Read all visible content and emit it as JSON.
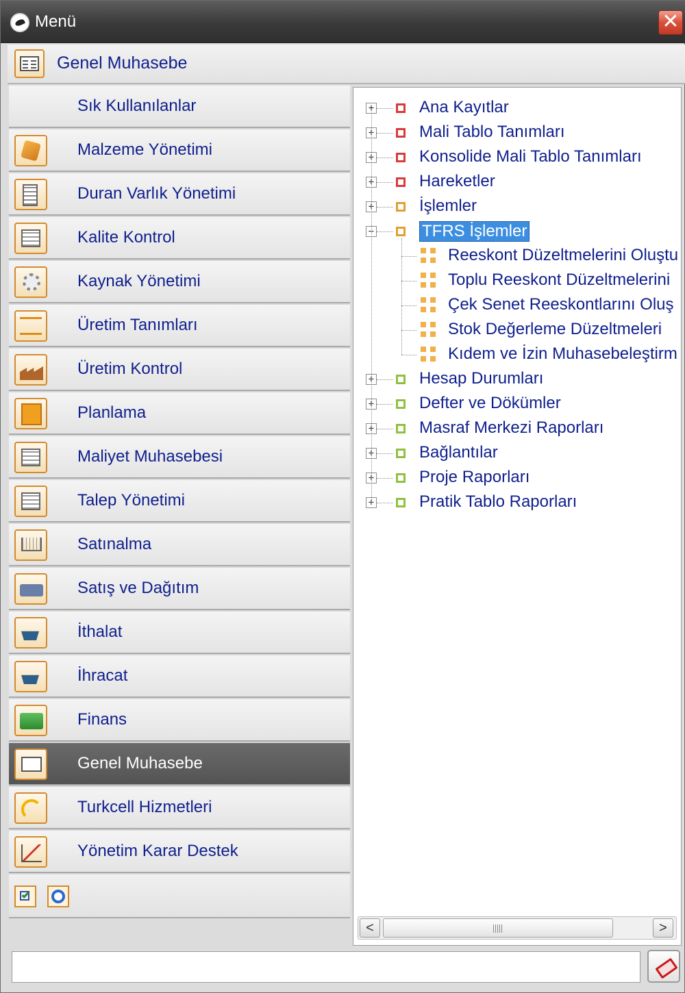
{
  "window": {
    "title": "Menü",
    "close_label": "✕"
  },
  "header": {
    "title": "Genel Muhasebe",
    "icon": "ledger-icon"
  },
  "nav": {
    "items": [
      {
        "label": "Sık Kullanılanlar",
        "icon": "none"
      },
      {
        "label": "Malzeme Yönetimi",
        "icon": "box-icon"
      },
      {
        "label": "Duran Varlık Yönetimi",
        "icon": "building-icon"
      },
      {
        "label": "Kalite Kontrol",
        "icon": "quality-doc-icon"
      },
      {
        "label": "Kaynak Yönetimi",
        "icon": "gears-icon"
      },
      {
        "label": "Üretim Tanımları",
        "icon": "flowchart-icon"
      },
      {
        "label": "Üretim Kontrol",
        "icon": "factory-icon"
      },
      {
        "label": "Planlama",
        "icon": "plan-icon"
      },
      {
        "label": "Maliyet Muhasebesi",
        "icon": "cost-ledger-icon"
      },
      {
        "label": "Talep Yönetimi",
        "icon": "request-doc-icon"
      },
      {
        "label": "Satınalma",
        "icon": "cart-icon"
      },
      {
        "label": "Satış ve Dağıtım",
        "icon": "truck-icon"
      },
      {
        "label": "İthalat",
        "icon": "import-ship-icon"
      },
      {
        "label": "İhracat",
        "icon": "export-ship-icon"
      },
      {
        "label": "Finans",
        "icon": "money-icon"
      },
      {
        "label": "Genel Muhasebe",
        "icon": "ledger-icon",
        "active": true
      },
      {
        "label": "Turkcell Hizmetleri",
        "icon": "turkcell-icon"
      },
      {
        "label": "Yönetim Karar Destek",
        "icon": "chart-icon"
      }
    ],
    "tools": [
      "checklist-icon",
      "refresh-icon"
    ]
  },
  "tree": {
    "nodes": [
      {
        "label": "Ana Kayıtlar",
        "color": "#d83a3a",
        "expanded": false
      },
      {
        "label": "Mali Tablo Tanımları",
        "color": "#d83a3a",
        "expanded": false
      },
      {
        "label": "Konsolide Mali Tablo Tanımları",
        "color": "#d83a3a",
        "expanded": false
      },
      {
        "label": "Hareketler",
        "color": "#d83a3a",
        "expanded": false
      },
      {
        "label": "İşlemler",
        "color": "#e0a030",
        "expanded": false
      },
      {
        "label": "TFRS İşlemler",
        "color": "#e0a030",
        "expanded": true,
        "selected": true,
        "children": [
          "Reeskont Düzeltmelerini Oluştu",
          "Toplu Reeskont Düzeltmelerini",
          "Çek Senet Reeskontlarını Oluş",
          "Stok Değerleme Düzeltmeleri",
          "Kıdem ve İzin Muhasebeleştirm"
        ]
      },
      {
        "label": "Hesap Durumları",
        "color": "#90c040",
        "expanded": false
      },
      {
        "label": "Defter ve Dökümler",
        "color": "#90c040",
        "expanded": false
      },
      {
        "label": "Masraf Merkezi Raporları",
        "color": "#90c040",
        "expanded": false
      },
      {
        "label": "Bağlantılar",
        "color": "#90c040",
        "expanded": false
      },
      {
        "label": "Proje Raporları",
        "color": "#90c040",
        "expanded": false
      },
      {
        "label": "Pratik Tablo Raporları",
        "color": "#90c040",
        "expanded": false
      }
    ],
    "scrollbar": {
      "left_arrow": "<",
      "right_arrow": ">"
    }
  },
  "bottom": {
    "search_value": "",
    "clear_icon": "eraser-icon"
  }
}
